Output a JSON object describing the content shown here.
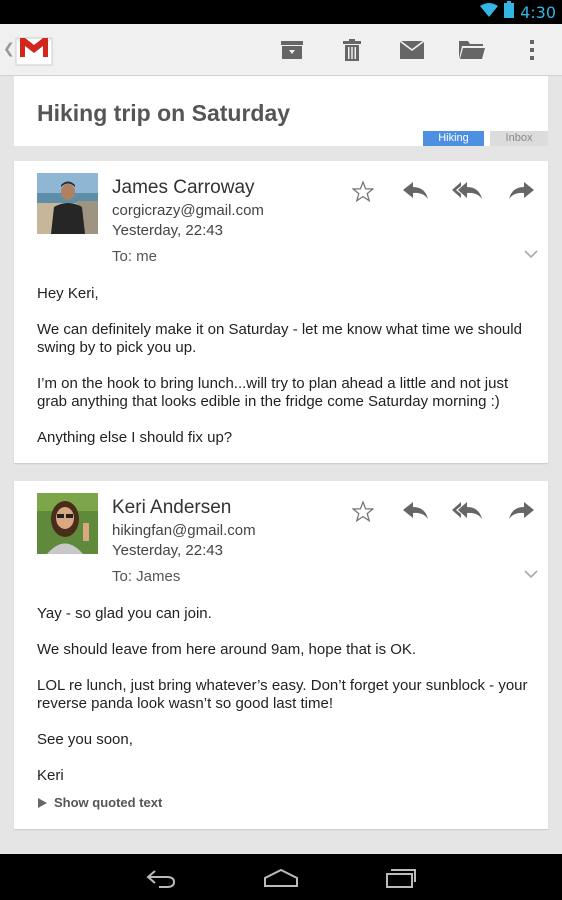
{
  "status_bar": {
    "time": "4:30",
    "icons": [
      "wifi-icon",
      "battery-icon"
    ]
  },
  "action_bar": {
    "app_icon": "gmail-logo",
    "actions": [
      "archive-icon",
      "delete-icon",
      "mark-unread-icon",
      "move-to-folder-icon",
      "overflow-menu-icon"
    ]
  },
  "conversation": {
    "subject": "Hiking trip on Saturday",
    "labels": [
      {
        "text": "Hiking",
        "color": "#4d8fe0"
      },
      {
        "text": "Inbox",
        "color": "#dcdcdc"
      }
    ]
  },
  "messages": [
    {
      "sender": "James Carroway",
      "email": "corgicrazy@gmail.com",
      "time": "Yesterday, 22:43",
      "to": "To: me",
      "body": [
        "Hey Keri,",
        "We can definitely make it on Saturday - let me know what time we should swing by to pick you up.",
        "I’m on the hook to bring lunch...will try to plan ahead a little and not just grab anything that looks edible in the fridge come Saturday morning :)",
        "Anything else I should fix up?"
      ]
    },
    {
      "sender": "Keri Andersen",
      "email": "hikingfan@gmail.com",
      "time": "Yesterday, 22:43",
      "to": "To: James",
      "body": [
        "Yay - so glad you can join.",
        "We should leave from here around 9am, hope that is OK.",
        "LOL re lunch, just bring whatever’s easy. Don’t forget your sunblock - your reverse panda look wasn’t so good last time!",
        "See you soon,",
        "Keri"
      ],
      "show_quoted": "Show quoted text"
    }
  ],
  "nav_bar": {
    "buttons": [
      "back-icon",
      "home-icon",
      "recents-icon"
    ]
  },
  "colors": {
    "accent": "#33b5e5",
    "label_hiking": "#4d8fe0",
    "icon_gray": "#666666",
    "page_bg": "#e5e5e5"
  }
}
